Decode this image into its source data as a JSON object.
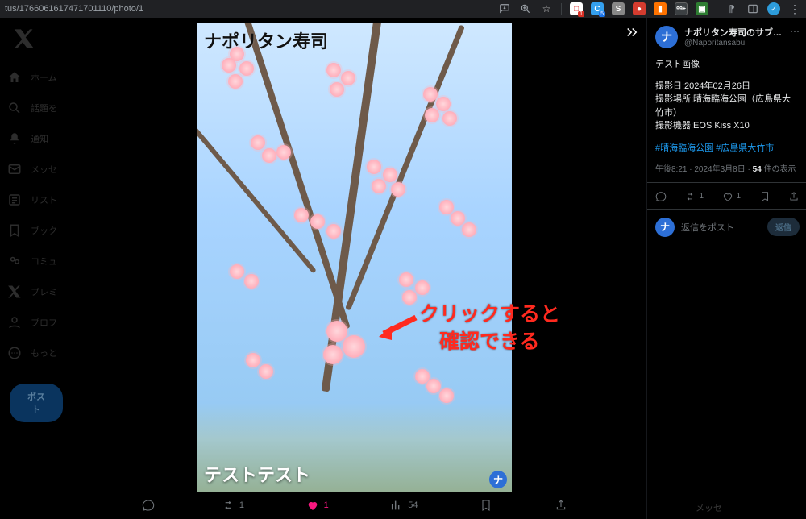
{
  "browser": {
    "url_fragment": "tus/1766061617471701110/photo/1",
    "tab_badge": "99+",
    "ext_badge1": "1",
    "ext_badge2": "5"
  },
  "sidebar": {
    "items": [
      {
        "label": "ホーム"
      },
      {
        "label": "話題を"
      },
      {
        "label": "通知"
      },
      {
        "label": "メッセ"
      },
      {
        "label": "リスト"
      },
      {
        "label": "ブック"
      },
      {
        "label": "コミュ"
      },
      {
        "label": "プレミ"
      },
      {
        "label": "プロフ"
      },
      {
        "label": "もっと"
      }
    ],
    "post_button": "ポスト"
  },
  "media": {
    "overlay_top": "ナポリタン寿司",
    "overlay_bottom": "テストテスト",
    "badge": "ナ",
    "actions": {
      "reply_count": "",
      "retweet_count": "1",
      "like_count": "1",
      "view_count": "54"
    }
  },
  "annotation": {
    "text": "クリックすると\n　確認できる"
  },
  "tweet": {
    "avatar_letter": "ナ",
    "display_name": "ナポリタン寿司のサブ垢@広島住み…",
    "handle": "@Naporitansabu",
    "body_lead": "テスト画像",
    "body_meta1": "撮影日:2024年02月26日",
    "body_meta2": "撮影場所:晴海臨海公園（広島県大竹市）",
    "body_meta3": "撮影機器:EOS Kiss X10",
    "hashtags": "#晴海臨海公園 #広島県大竹市",
    "time": "午後8:21 · 2024年3月8日 · ",
    "views_number": "54",
    "views_suffix": " 件の表示",
    "engage": {
      "retweet": "1",
      "like": "1"
    },
    "reply_placeholder": "返信をポスト",
    "reply_button": "返信"
  },
  "overlay_bottom_right": "メッセ"
}
